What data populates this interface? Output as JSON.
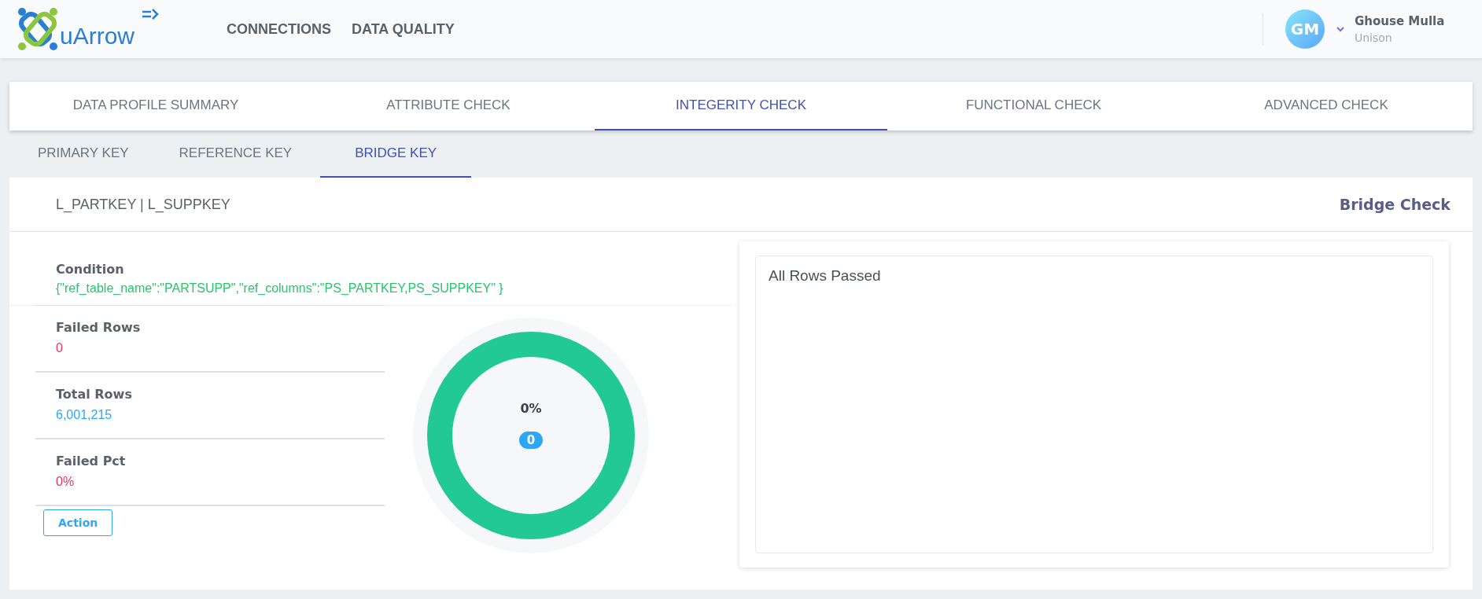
{
  "header": {
    "logo_text": "uArrow",
    "nav": [
      {
        "label": "CONNECTIONS"
      },
      {
        "label": "DATA QUALITY"
      }
    ],
    "user": {
      "initials": "GM",
      "name": "Ghouse Mulla",
      "org": "Unison"
    }
  },
  "tabs": [
    {
      "label": "DATA PROFILE SUMMARY",
      "selected": false
    },
    {
      "label": "ATTRIBUTE CHECK",
      "selected": false
    },
    {
      "label": "INTEGERITY CHECK",
      "selected": true
    },
    {
      "label": "FUNCTIONAL CHECK",
      "selected": false
    },
    {
      "label": "ADVANCED CHECK",
      "selected": false
    }
  ],
  "subtabs": [
    {
      "label": "PRIMARY KEY",
      "selected": false
    },
    {
      "label": "REFERENCE KEY",
      "selected": false
    },
    {
      "label": "BRIDGE KEY",
      "selected": true
    }
  ],
  "card": {
    "columns": "L_PARTKEY | L_SUPPKEY",
    "check_name": "Bridge Check",
    "condition": {
      "label": "Condition",
      "value": "{\"ref_table_name\":\"PARTSUPP\",\"ref_columns\":\"PS_PARTKEY,PS_SUPPKEY\" }"
    },
    "metrics": [
      {
        "label": "Failed Rows",
        "value": "0",
        "color": "#e8335e"
      },
      {
        "label": "Total Rows",
        "value": "6,001,215",
        "color": "#2ea6f7"
      },
      {
        "label": "Failed Pct",
        "value": "0%",
        "color": "#e8335e"
      }
    ],
    "action_button": "Action",
    "donut": {
      "percent": "0%",
      "count": "0",
      "level": 0
    },
    "result_text": "All Rows Passed"
  }
}
